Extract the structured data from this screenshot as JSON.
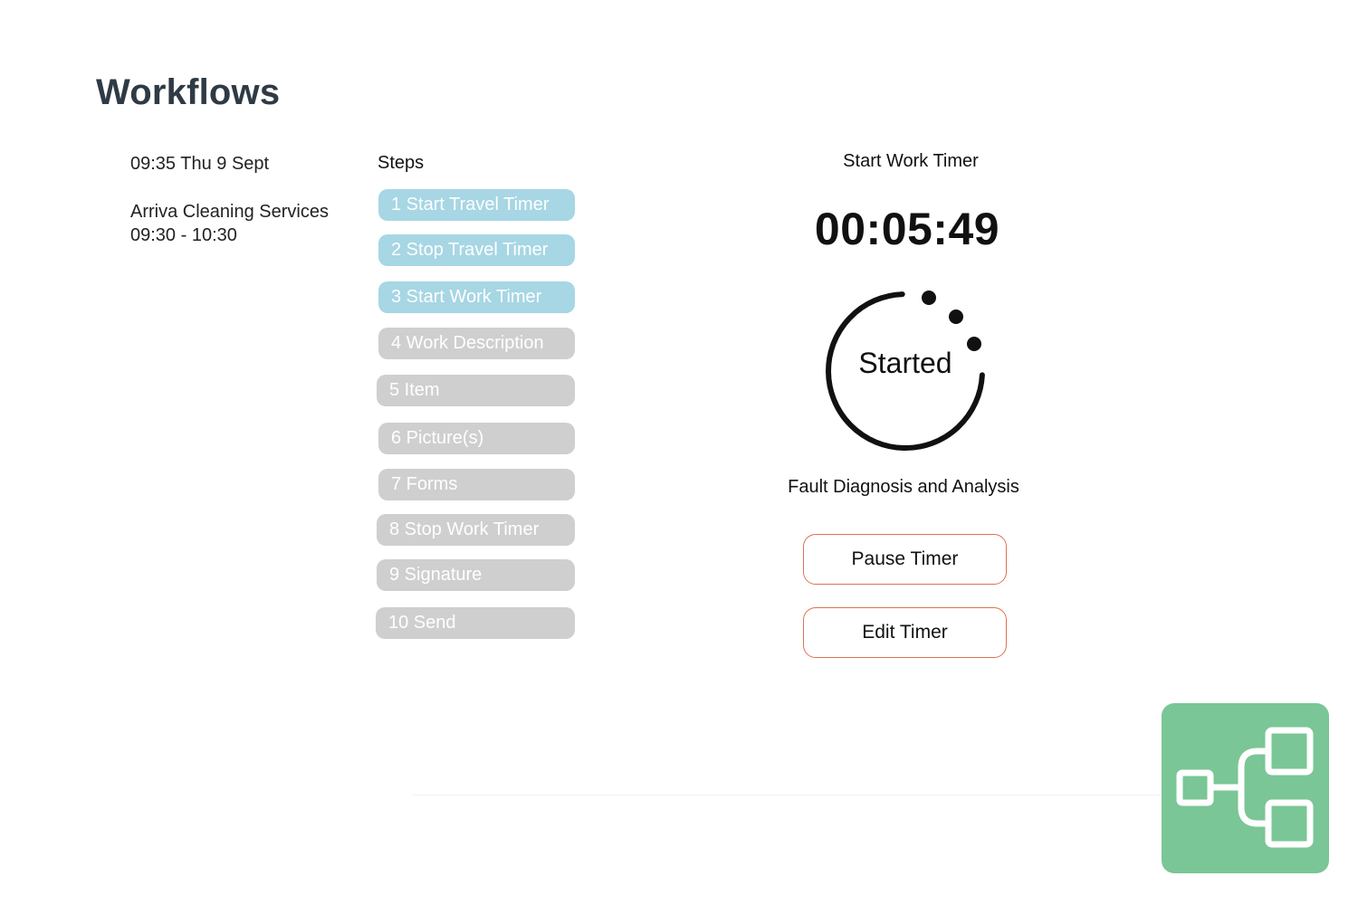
{
  "page": {
    "title": "Workflows"
  },
  "job": {
    "datetime": "09:35 Thu 9 Sept",
    "client": "Arriva Cleaning Services",
    "time_window": "09:30 - 10:30"
  },
  "steps": {
    "heading": "Steps",
    "items": [
      {
        "label": "1 Start Travel Timer",
        "state": "completed"
      },
      {
        "label": "2 Stop Travel Timer",
        "state": "completed"
      },
      {
        "label": "3 Start Work Timer",
        "state": "completed"
      },
      {
        "label": "4 Work Description",
        "state": "pending"
      },
      {
        "label": "5 Item",
        "state": "pending"
      },
      {
        "label": "6 Picture(s)",
        "state": "pending"
      },
      {
        "label": "7 Forms",
        "state": "pending"
      },
      {
        "label": "8 Stop Work Timer",
        "state": "pending"
      },
      {
        "label": "9 Signature",
        "state": "pending"
      },
      {
        "label": "10 Send",
        "state": "pending"
      }
    ]
  },
  "timer": {
    "title": "Start Work Timer",
    "value": "00:05:49",
    "status": "Started",
    "job_label": "Fault Diagnosis and Analysis",
    "pause_label": "Pause Timer",
    "edit_label": "Edit Timer"
  },
  "colors": {
    "completed_step": "#a7d6e4",
    "pending_step": "#cfcfcf",
    "button_border": "#e07050",
    "logo_background": "#7ac696",
    "title_text": "#2f3a45"
  },
  "icons": {
    "logo": "workflow-tree-icon",
    "status_ring": "loading-ring-icon"
  }
}
